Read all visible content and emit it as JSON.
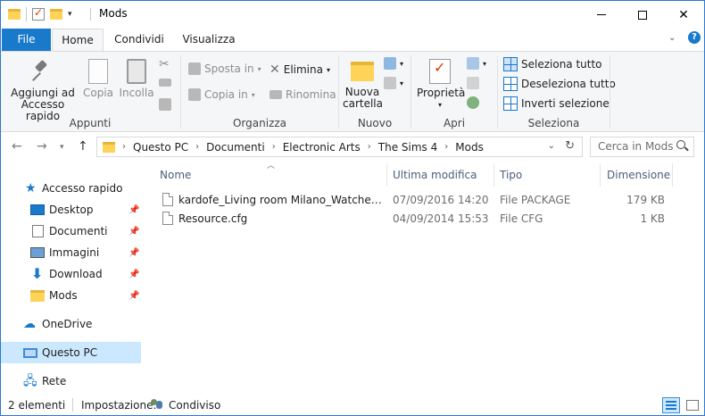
{
  "window": {
    "title": "Mods"
  },
  "tabs": {
    "file": "File",
    "home": "Home",
    "share": "Condividi",
    "view": "Visualizza"
  },
  "ribbon": {
    "appunti": {
      "label": "Appunti",
      "pin_line1": "Aggiungi ad",
      "pin_line2": "Accesso rapido",
      "copy": "Copia",
      "paste": "Incolla"
    },
    "organizza": {
      "label": "Organizza",
      "move_to": "Sposta in",
      "copy_to": "Copia in",
      "delete": "Elimina",
      "rename": "Rinomina"
    },
    "nuovo": {
      "label": "Nuovo",
      "new_folder_line1": "Nuova",
      "new_folder_line2": "cartella"
    },
    "apri": {
      "label": "Apri",
      "properties": "Proprietà"
    },
    "seleziona": {
      "label": "Seleziona",
      "select_all": "Seleziona tutto",
      "select_none": "Deseleziona tutto",
      "invert": "Inverti selezione"
    }
  },
  "address": {
    "segments": [
      "Questo PC",
      "Documenti",
      "Electronic Arts",
      "The Sims 4",
      "Mods"
    ],
    "search_placeholder": "Cerca in Mods"
  },
  "navpane": {
    "quick_access": "Accesso rapido",
    "items": [
      "Desktop",
      "Documenti",
      "Immagini",
      "Download",
      "Mods"
    ],
    "onedrive": "OneDrive",
    "this_pc": "Questo PC",
    "network": "Rete"
  },
  "columns": {
    "name": "Nome",
    "modified": "Ultima modifica",
    "type": "Tipo",
    "size": "Dimensione"
  },
  "files": [
    {
      "name": "kardofe_Living room Milano_Watches.pa...",
      "modified": "07/09/2016 14:20",
      "type": "File PACKAGE",
      "size": "179 KB"
    },
    {
      "name": "Resource.cfg",
      "modified": "04/09/2014 15:53",
      "type": "File CFG",
      "size": "1 KB"
    }
  ],
  "status": {
    "count": "2 elementi",
    "sharing_label": "Impostazione:",
    "sharing_value": "Condiviso"
  }
}
